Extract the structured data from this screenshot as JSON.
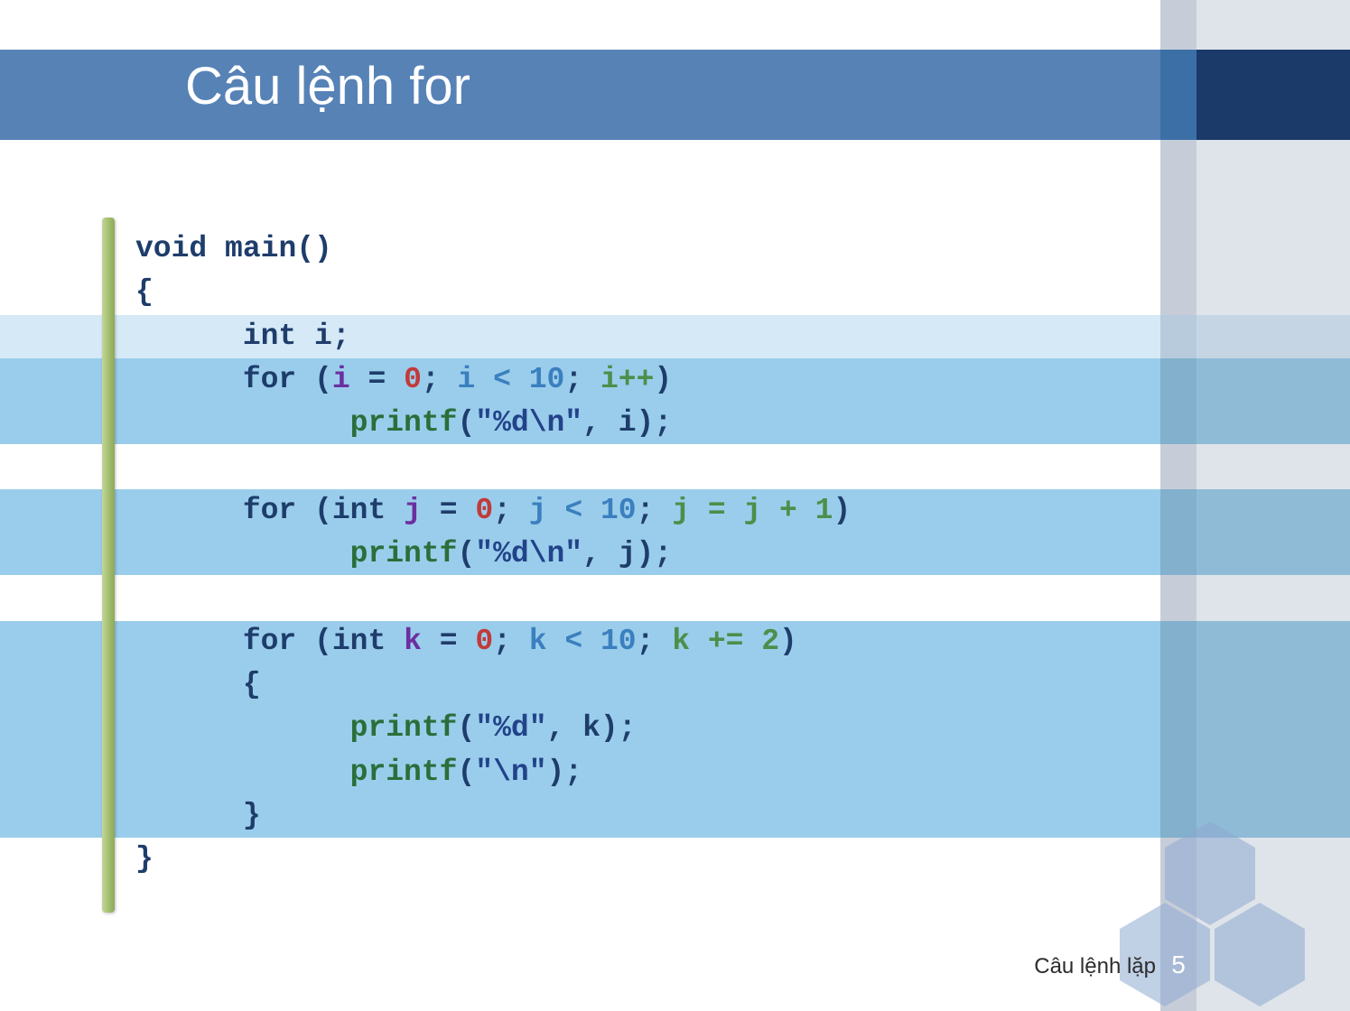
{
  "title": "Câu lệnh for",
  "footer": "Câu lệnh lặp",
  "page_number": "5",
  "code": {
    "l1": {
      "kw1": "void",
      "sp1": " ",
      "fn": "main",
      "rest": "()"
    },
    "l2": {
      "brace": "{"
    },
    "l3": {
      "indent": "      ",
      "kw": "int",
      "rest": " i;"
    },
    "l4": {
      "indent": "      ",
      "kw": "for",
      "sp": " (",
      "v1": "i",
      "eq": " = ",
      "n1": "0",
      "semi1": ";",
      "sp2": " ",
      "cond": "i < 10",
      "semi2": ";",
      "sp3": " ",
      "inc": "i++",
      "close": ")"
    },
    "l5": {
      "indent": "            ",
      "fn": "printf",
      "open": "(",
      "str": "\"%d\\n\"",
      "rest": ", i);"
    },
    "l6": {
      "blank": ""
    },
    "l7": {
      "indent": "      ",
      "kw": "for",
      "sp": " (",
      "kw2": "int",
      "sp2": " ",
      "v1": "j",
      "eq": " = ",
      "n1": "0",
      "semi1": ";",
      "sp3": " ",
      "cond": "j < 10",
      "semi2": ";",
      "sp4": " ",
      "inc": "j = j + 1",
      "close": ")"
    },
    "l8": {
      "indent": "            ",
      "fn": "printf",
      "open": "(",
      "str": "\"%d\\n\"",
      "rest": ", j);"
    },
    "l9": {
      "blank": ""
    },
    "l10": {
      "indent": "      ",
      "kw": "for",
      "sp": " (",
      "kw2": "int",
      "sp2": " ",
      "v1": "k",
      "eq": " = ",
      "n1": "0",
      "semi1": ";",
      "sp3": " ",
      "cond": "k < 10",
      "semi2": ";",
      "sp4": " ",
      "inc": "k += 2",
      "close": ")"
    },
    "l11": {
      "indent": "      ",
      "brace": "{"
    },
    "l12": {
      "indent": "            ",
      "fn": "printf",
      "open": "(",
      "str": "\"%d\"",
      "rest": ", k);"
    },
    "l13": {
      "indent": "            ",
      "fn": "printf",
      "open": "(",
      "str": "\"\\n\"",
      "rest": ");"
    },
    "l14": {
      "indent": "      ",
      "brace": "}"
    },
    "l15": {
      "brace": "}"
    }
  }
}
